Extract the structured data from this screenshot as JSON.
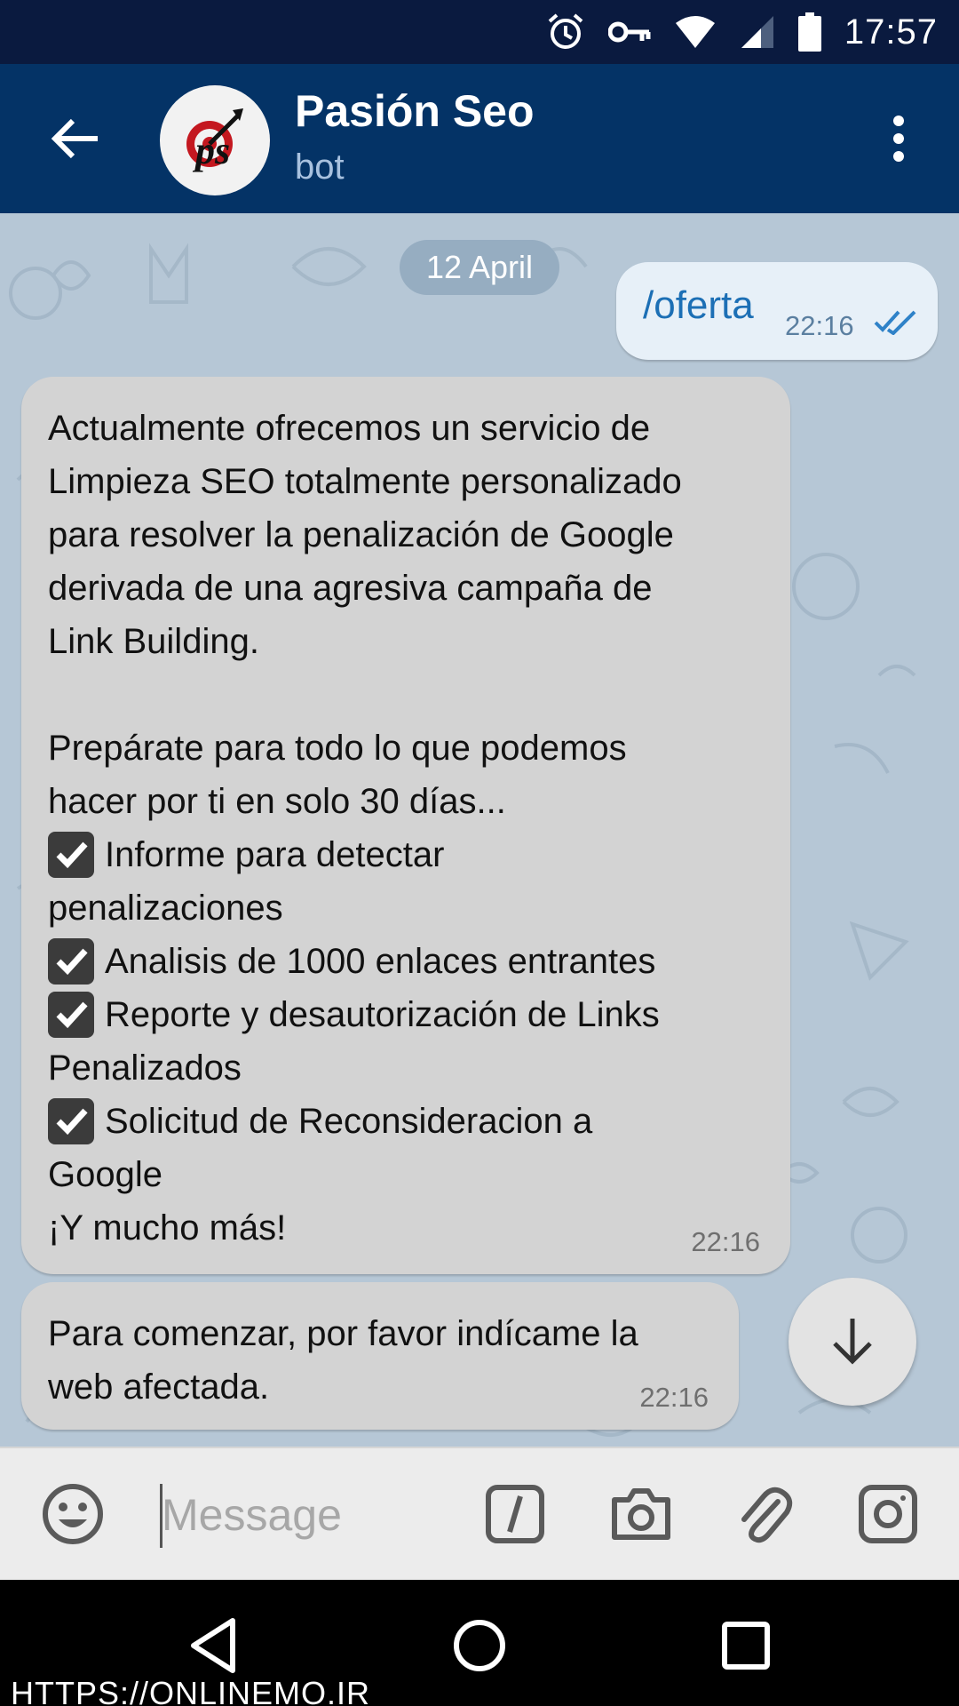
{
  "status_bar": {
    "time": "17:57",
    "icons": [
      "alarm-icon",
      "key-icon",
      "wifi-icon",
      "signal-icon",
      "battery-icon"
    ]
  },
  "app_bar": {
    "title": "Pasión Seo",
    "subtitle": "bot",
    "avatar_logo_text": "ps",
    "colors": {
      "bar": "#043366",
      "status": "#0a1a3f"
    }
  },
  "chat": {
    "date_label": "12 April",
    "outgoing": {
      "text": "/oferta",
      "time": "22:16",
      "status_icon": "double-check-icon"
    },
    "messages": [
      {
        "lines": [
          "Actualmente ofrecemos un servicio de",
          "Limpieza SEO totalmente personalizado",
          "para resolver la penalización de Google",
          "derivada de una agresiva campaña de",
          "Link Building.",
          "",
          "Prepárate para todo lo que podemos",
          "hacer por ti en solo 30 días...",
          "Informe para detectar",
          "penalizaciones",
          "Analisis de 1000 enlaces entrantes",
          "Reporte y desautorización de Links",
          "Penalizados",
          "Solicitud de Reconsideracion a",
          "Google",
          "¡Y mucho más!"
        ],
        "time": "22:16"
      },
      {
        "lines": [
          "Para comenzar, por favor indícame la",
          "web afectada."
        ],
        "time": "22:16"
      }
    ]
  },
  "input_bar": {
    "placeholder": "Message",
    "icons": [
      "emoji-icon",
      "slash-command-icon",
      "camera-icon",
      "attach-icon",
      "instagram-icon"
    ]
  },
  "nav_bar": {
    "icons": [
      "nav-back-icon",
      "nav-home-icon",
      "nav-recent-icon"
    ]
  },
  "watermark": "HTTPS://ONLINEMO.IR"
}
